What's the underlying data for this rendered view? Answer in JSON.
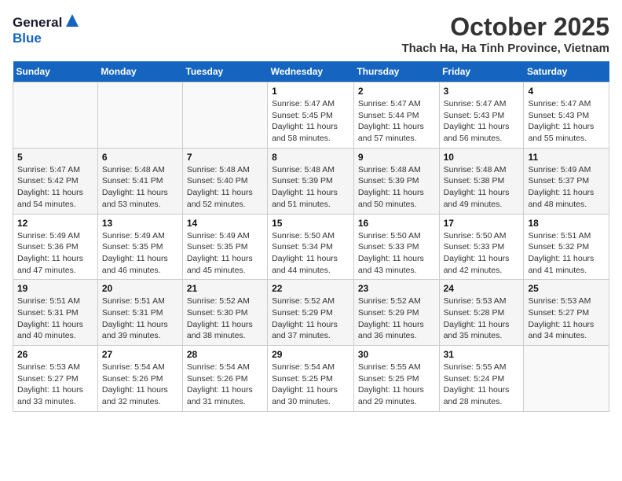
{
  "header": {
    "logo_line1": "General",
    "logo_line2": "Blue",
    "month": "October 2025",
    "location": "Thach Ha, Ha Tinh Province, Vietnam"
  },
  "days_of_week": [
    "Sunday",
    "Monday",
    "Tuesday",
    "Wednesday",
    "Thursday",
    "Friday",
    "Saturday"
  ],
  "weeks": [
    [
      {
        "day": "",
        "info": ""
      },
      {
        "day": "",
        "info": ""
      },
      {
        "day": "",
        "info": ""
      },
      {
        "day": "1",
        "info": "Sunrise: 5:47 AM\nSunset: 5:45 PM\nDaylight: 11 hours\nand 58 minutes."
      },
      {
        "day": "2",
        "info": "Sunrise: 5:47 AM\nSunset: 5:44 PM\nDaylight: 11 hours\nand 57 minutes."
      },
      {
        "day": "3",
        "info": "Sunrise: 5:47 AM\nSunset: 5:43 PM\nDaylight: 11 hours\nand 56 minutes."
      },
      {
        "day": "4",
        "info": "Sunrise: 5:47 AM\nSunset: 5:43 PM\nDaylight: 11 hours\nand 55 minutes."
      }
    ],
    [
      {
        "day": "5",
        "info": "Sunrise: 5:47 AM\nSunset: 5:42 PM\nDaylight: 11 hours\nand 54 minutes."
      },
      {
        "day": "6",
        "info": "Sunrise: 5:48 AM\nSunset: 5:41 PM\nDaylight: 11 hours\nand 53 minutes."
      },
      {
        "day": "7",
        "info": "Sunrise: 5:48 AM\nSunset: 5:40 PM\nDaylight: 11 hours\nand 52 minutes."
      },
      {
        "day": "8",
        "info": "Sunrise: 5:48 AM\nSunset: 5:39 PM\nDaylight: 11 hours\nand 51 minutes."
      },
      {
        "day": "9",
        "info": "Sunrise: 5:48 AM\nSunset: 5:39 PM\nDaylight: 11 hours\nand 50 minutes."
      },
      {
        "day": "10",
        "info": "Sunrise: 5:48 AM\nSunset: 5:38 PM\nDaylight: 11 hours\nand 49 minutes."
      },
      {
        "day": "11",
        "info": "Sunrise: 5:49 AM\nSunset: 5:37 PM\nDaylight: 11 hours\nand 48 minutes."
      }
    ],
    [
      {
        "day": "12",
        "info": "Sunrise: 5:49 AM\nSunset: 5:36 PM\nDaylight: 11 hours\nand 47 minutes."
      },
      {
        "day": "13",
        "info": "Sunrise: 5:49 AM\nSunset: 5:35 PM\nDaylight: 11 hours\nand 46 minutes."
      },
      {
        "day": "14",
        "info": "Sunrise: 5:49 AM\nSunset: 5:35 PM\nDaylight: 11 hours\nand 45 minutes."
      },
      {
        "day": "15",
        "info": "Sunrise: 5:50 AM\nSunset: 5:34 PM\nDaylight: 11 hours\nand 44 minutes."
      },
      {
        "day": "16",
        "info": "Sunrise: 5:50 AM\nSunset: 5:33 PM\nDaylight: 11 hours\nand 43 minutes."
      },
      {
        "day": "17",
        "info": "Sunrise: 5:50 AM\nSunset: 5:33 PM\nDaylight: 11 hours\nand 42 minutes."
      },
      {
        "day": "18",
        "info": "Sunrise: 5:51 AM\nSunset: 5:32 PM\nDaylight: 11 hours\nand 41 minutes."
      }
    ],
    [
      {
        "day": "19",
        "info": "Sunrise: 5:51 AM\nSunset: 5:31 PM\nDaylight: 11 hours\nand 40 minutes."
      },
      {
        "day": "20",
        "info": "Sunrise: 5:51 AM\nSunset: 5:31 PM\nDaylight: 11 hours\nand 39 minutes."
      },
      {
        "day": "21",
        "info": "Sunrise: 5:52 AM\nSunset: 5:30 PM\nDaylight: 11 hours\nand 38 minutes."
      },
      {
        "day": "22",
        "info": "Sunrise: 5:52 AM\nSunset: 5:29 PM\nDaylight: 11 hours\nand 37 minutes."
      },
      {
        "day": "23",
        "info": "Sunrise: 5:52 AM\nSunset: 5:29 PM\nDaylight: 11 hours\nand 36 minutes."
      },
      {
        "day": "24",
        "info": "Sunrise: 5:53 AM\nSunset: 5:28 PM\nDaylight: 11 hours\nand 35 minutes."
      },
      {
        "day": "25",
        "info": "Sunrise: 5:53 AM\nSunset: 5:27 PM\nDaylight: 11 hours\nand 34 minutes."
      }
    ],
    [
      {
        "day": "26",
        "info": "Sunrise: 5:53 AM\nSunset: 5:27 PM\nDaylight: 11 hours\nand 33 minutes."
      },
      {
        "day": "27",
        "info": "Sunrise: 5:54 AM\nSunset: 5:26 PM\nDaylight: 11 hours\nand 32 minutes."
      },
      {
        "day": "28",
        "info": "Sunrise: 5:54 AM\nSunset: 5:26 PM\nDaylight: 11 hours\nand 31 minutes."
      },
      {
        "day": "29",
        "info": "Sunrise: 5:54 AM\nSunset: 5:25 PM\nDaylight: 11 hours\nand 30 minutes."
      },
      {
        "day": "30",
        "info": "Sunrise: 5:55 AM\nSunset: 5:25 PM\nDaylight: 11 hours\nand 29 minutes."
      },
      {
        "day": "31",
        "info": "Sunrise: 5:55 AM\nSunset: 5:24 PM\nDaylight: 11 hours\nand 28 minutes."
      },
      {
        "day": "",
        "info": ""
      }
    ]
  ]
}
